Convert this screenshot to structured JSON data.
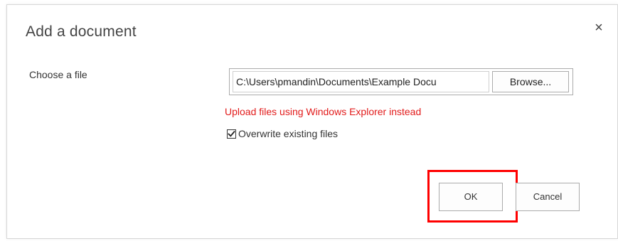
{
  "dialog": {
    "title": "Add a document",
    "close_glyph": "×",
    "close_icon": "close-icon"
  },
  "form": {
    "choose_file_label": "Choose a file",
    "file_path_value": "C:\\Users\\pmandin\\Documents\\Example Docu",
    "browse_label": "Browse...",
    "explorer_link_text": "Upload files using Windows Explorer instead",
    "overwrite_label": "Overwrite existing files",
    "overwrite_checked": true
  },
  "actions": {
    "ok_label": "OK",
    "cancel_label": "Cancel"
  },
  "colors": {
    "link_red": "#e21b1b",
    "highlight_red": "#ff0000",
    "title_gray": "#444444"
  }
}
